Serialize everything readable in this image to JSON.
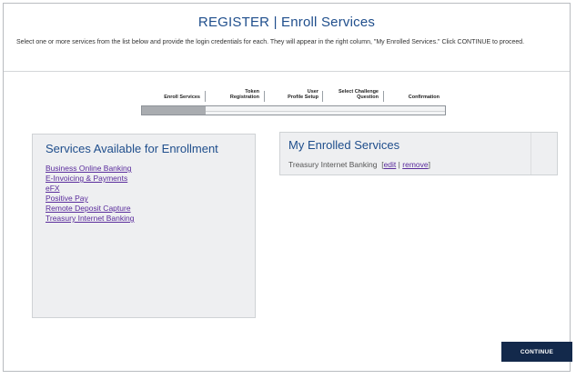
{
  "header": {
    "title": "REGISTER | Enroll Services",
    "instructions": "Select one or more services from the list below and provide the login credentials for each. They will appear in the right column, \"My Enrolled Services.\" Click CONTINUE to proceed."
  },
  "progress": {
    "steps": [
      {
        "line1": "",
        "line2": "Enroll Services"
      },
      {
        "line1": "Token",
        "line2": "Registration"
      },
      {
        "line1": "User",
        "line2": "Profile Setup"
      },
      {
        "line1": "Select Challenge",
        "line2": "Question"
      },
      {
        "line1": "",
        "line2": "Confirmation"
      }
    ],
    "completed_fraction": 0.21
  },
  "available": {
    "heading": "Services Available for Enrollment",
    "items": [
      "Business Online Banking",
      "E-Invoicing & Payments",
      "eFX",
      "Positive Pay",
      "Remote Deposit Capture",
      "Treasury Internet Banking"
    ]
  },
  "enrolled": {
    "heading": "My Enrolled Services",
    "items": [
      {
        "name": "Treasury Internet Banking",
        "edit_label": "edit",
        "separator": "|",
        "remove_label": "remove"
      }
    ]
  },
  "actions": {
    "continue_label": "CONTINUE"
  },
  "colors": {
    "title": "#1f4e8c",
    "link": "#5a2c9c",
    "button_bg": "#13294b",
    "panel_bg": "#eeeff1"
  }
}
